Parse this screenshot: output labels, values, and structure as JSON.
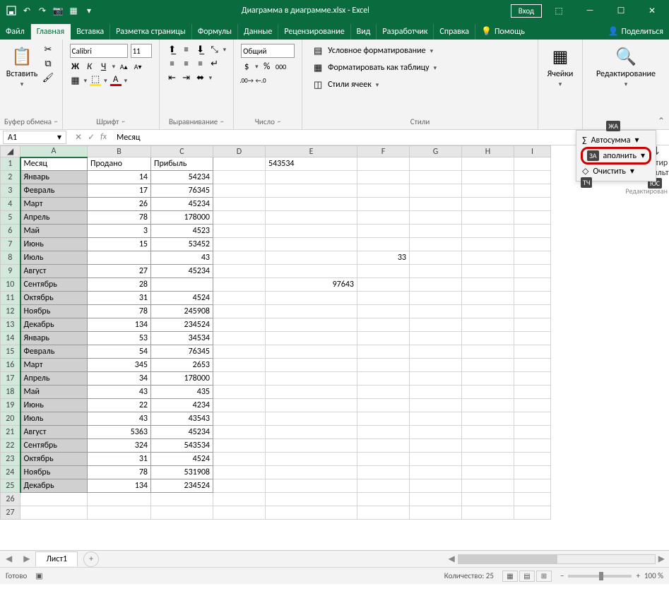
{
  "title": "Диаграмма в диаграмме.xlsx - Excel",
  "login_label": "Вход",
  "tabs": {
    "file": "Файл",
    "home": "Главная",
    "insert": "Вставка",
    "layout": "Разметка страницы",
    "formulas": "Формулы",
    "data": "Данные",
    "review": "Рецензирование",
    "view": "Вид",
    "developer": "Разработчик",
    "help": "Справка",
    "tellme": "Помощь",
    "share": "Поделиться"
  },
  "ribbon": {
    "clipboard": {
      "paste": "Вставить",
      "label": "Буфер обмена"
    },
    "font": {
      "name": "Calibri",
      "size": "11",
      "label": "Шрифт"
    },
    "alignment": {
      "label": "Выравнивание"
    },
    "number": {
      "format": "Общий",
      "label": "Число"
    },
    "styles": {
      "cond": "Условное форматирование",
      "table": "Форматировать как таблицу",
      "cell": "Стили ячеек",
      "label": "Стили"
    },
    "cells": {
      "label": "Ячейки"
    },
    "editing": {
      "label": "Редактирование",
      "autosum": "Автосумма",
      "fill": "аполнить",
      "clear": "Очистить",
      "sort": "Сортир и фильт",
      "editing_hint": "Редактирован",
      "badge_bold": "ЖА",
      "badge_fill": "ЗА",
      "badge_clear": "ТЧ",
      "badge_sort": "ЮС"
    }
  },
  "namebox": "A1",
  "formula": "Месяц",
  "columns": [
    "A",
    "B",
    "C",
    "D",
    "E",
    "F",
    "G",
    "H",
    "I"
  ],
  "headers": {
    "A": "Месяц",
    "B": "Продано",
    "C": "Прибыль"
  },
  "rows": [
    {
      "n": 1,
      "A": "Месяц",
      "B": "Продано",
      "C": "Прибыль",
      "E": "543534"
    },
    {
      "n": 2,
      "A": "Январь",
      "B": "14",
      "C": "54234"
    },
    {
      "n": 3,
      "A": "Февраль",
      "B": "17",
      "C": "76345"
    },
    {
      "n": 4,
      "A": "Март",
      "B": "26",
      "C": "45234"
    },
    {
      "n": 5,
      "A": "Апрель",
      "B": "78",
      "C": "178000"
    },
    {
      "n": 6,
      "A": "Май",
      "B": "3",
      "C": "4523"
    },
    {
      "n": 7,
      "A": "Июнь",
      "B": "15",
      "C": "53452"
    },
    {
      "n": 8,
      "A": "Июль",
      "B": "",
      "C": "43",
      "F": "33"
    },
    {
      "n": 9,
      "A": "Август",
      "B": "27",
      "C": "45234"
    },
    {
      "n": 10,
      "A": "Сентябрь",
      "B": "28",
      "C": "",
      "E": "97643"
    },
    {
      "n": 11,
      "A": "Октябрь",
      "B": "31",
      "C": "4524"
    },
    {
      "n": 12,
      "A": "Ноябрь",
      "B": "78",
      "C": "245908"
    },
    {
      "n": 13,
      "A": "Декабрь",
      "B": "134",
      "C": "234524"
    },
    {
      "n": 14,
      "A": "Январь",
      "B": "53",
      "C": "34534"
    },
    {
      "n": 15,
      "A": "Февраль",
      "B": "54",
      "C": "76345"
    },
    {
      "n": 16,
      "A": "Март",
      "B": "345",
      "C": "2653"
    },
    {
      "n": 17,
      "A": "Апрель",
      "B": "34",
      "C": "178000"
    },
    {
      "n": 18,
      "A": "Май",
      "B": "43",
      "C": "435"
    },
    {
      "n": 19,
      "A": "Июнь",
      "B": "22",
      "C": "4234"
    },
    {
      "n": 20,
      "A": "Июль",
      "B": "43",
      "C": "43543"
    },
    {
      "n": 21,
      "A": "Август",
      "B": "5363",
      "C": "45234"
    },
    {
      "n": 22,
      "A": "Сентябрь",
      "B": "324",
      "C": "543534"
    },
    {
      "n": 23,
      "A": "Октябрь",
      "B": "31",
      "C": "4524"
    },
    {
      "n": 24,
      "A": "Ноябрь",
      "B": "78",
      "C": "531908"
    },
    {
      "n": 25,
      "A": "Декабрь",
      "B": "134",
      "C": "234524"
    }
  ],
  "sheet_tab": "Лист1",
  "status": {
    "ready": "Готово",
    "count_label": "Количество: 25",
    "zoom": "100 %"
  }
}
